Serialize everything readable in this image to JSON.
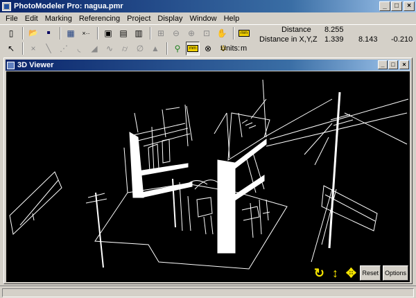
{
  "app": {
    "title": "PhotoModeler Pro: nagua.pmr",
    "window_buttons": {
      "minimize": "_",
      "maximize": "□",
      "close": "×"
    }
  },
  "menu": [
    "File",
    "Edit",
    "Marking",
    "Referencing",
    "Project",
    "Display",
    "Window",
    "Help"
  ],
  "toolbar1": [
    {
      "name": "new-icon",
      "glyph": "▯"
    },
    {
      "name": "open-icon",
      "glyph": "📂"
    },
    {
      "name": "save-icon",
      "glyph": "▪"
    },
    {
      "name": "photos-table-icon",
      "glyph": "▦"
    },
    {
      "name": "dots-icon",
      "glyph": "×··"
    },
    {
      "name": "open-photo-icon",
      "glyph": "▣"
    },
    {
      "name": "photo-table-icon",
      "glyph": "▤"
    },
    {
      "name": "table-icon",
      "glyph": "▥"
    },
    {
      "name": "zoom-fit-icon",
      "glyph": "⊞"
    },
    {
      "name": "zoom-out-icon",
      "glyph": "⊖"
    },
    {
      "name": "zoom-in-icon",
      "glyph": "⊕"
    },
    {
      "name": "zoom-box-icon",
      "glyph": "⊡"
    },
    {
      "name": "pan-icon",
      "glyph": "✋"
    },
    {
      "name": "measure-icon",
      "glyph": "mm"
    }
  ],
  "toolbar2": [
    {
      "name": "pointer-icon",
      "glyph": "↖"
    },
    {
      "name": "point-mark-icon",
      "glyph": "×"
    },
    {
      "name": "line-icon",
      "glyph": "╲"
    },
    {
      "name": "edge-icon",
      "glyph": "⋰"
    },
    {
      "name": "curve-icon",
      "glyph": "◟"
    },
    {
      "name": "surface-icon",
      "glyph": "◢"
    },
    {
      "name": "spline-icon",
      "glyph": "∿"
    },
    {
      "name": "cylinder-icon",
      "glyph": "⌭"
    },
    {
      "name": "path-icon",
      "glyph": "∅"
    },
    {
      "name": "triangle-mesh-icon",
      "glyph": "▲"
    },
    {
      "name": "runner-icon",
      "glyph": "⚲"
    },
    {
      "name": "measure-tool-icon",
      "glyph": "mm"
    },
    {
      "name": "lock-icon",
      "glyph": "⊗"
    },
    {
      "name": "scan-icon",
      "glyph": "✲"
    }
  ],
  "readout": {
    "distance_label": "Distance",
    "distance_value": "8.255",
    "xyz_label": "Distance in X,Y,Z",
    "x": "1.339",
    "y": "8.143",
    "z": "-0.210",
    "units_label": "Units:",
    "units_value": "m"
  },
  "viewer": {
    "title": "3D Viewer",
    "reset_label": "Reset",
    "options_label": "Options",
    "rotate_glyph": "↻",
    "updown_glyph": "↕",
    "move_glyph": "✥"
  },
  "colors": {
    "title_gradient_start": "#0a246a",
    "viewer_bg": "#000000",
    "nav_yellow": "#f5e400"
  }
}
